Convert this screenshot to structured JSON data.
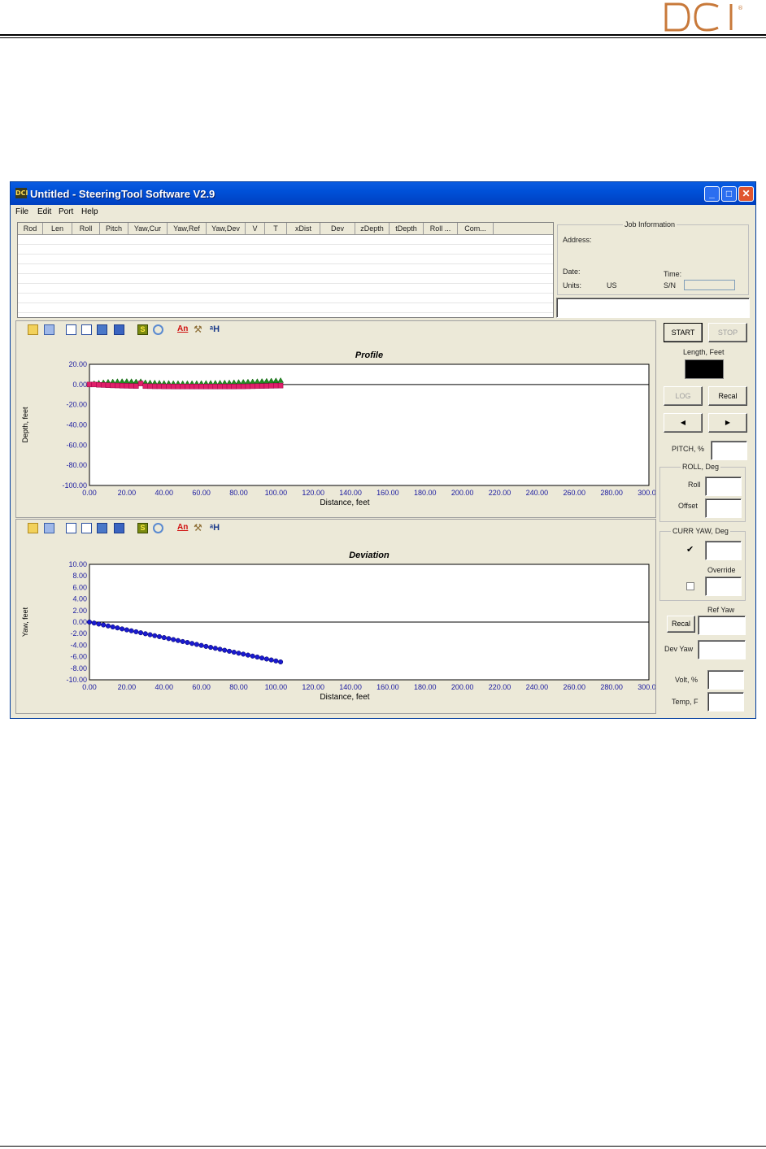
{
  "window": {
    "title": "Untitled - SteeringTool Software V2.9"
  },
  "logo_text": "DCI",
  "menu": [
    "File",
    "Edit",
    "Port",
    "Help"
  ],
  "grid": {
    "columns": [
      "Rod",
      "Len",
      "Roll",
      "Pitch",
      "Yaw,Cur",
      "Yaw,Ref",
      "Yaw,Dev",
      "V",
      "T",
      "xDist",
      "Dev",
      "zDepth",
      "tDepth",
      "Roll ...",
      "Com..."
    ]
  },
  "job": {
    "legend": "Job Information",
    "address_label": "Address:",
    "date_label": "Date:",
    "time_label": "Time:",
    "units_label": "Units:",
    "units_value": "US",
    "sn_label": "S/N"
  },
  "toolbar_icons": [
    "open-icon",
    "copy-icon",
    "page1-icon",
    "page2-icon",
    "list-icon",
    "table-icon",
    "s-icon",
    "zoom-icon",
    "an-icon",
    "tool-icon",
    "key-icon"
  ],
  "controls": {
    "start": "START",
    "stop": "STOP",
    "length_label": "Length, Feet",
    "log": "LOG",
    "recal": "Recal",
    "pitch_label": "PITCH, %",
    "roll_legend": "ROLL, Deg",
    "roll_label": "Roll",
    "offset_label": "Offset",
    "curr_yaw_legend": "CURR YAW, Deg",
    "override_label": "Override",
    "ref_yaw_label": "Ref Yaw",
    "recal2": "Recal",
    "dev_yaw_label": "Dev Yaw",
    "volt_label": "Volt, %",
    "temp_label": "Temp, F",
    "curr_yaw_checked": true,
    "override_checked": false
  },
  "chart_data": [
    {
      "type": "scatter",
      "title": "Profile",
      "xlabel": "Distance, feet",
      "ylabel": "Depth, feet",
      "xlim": [
        0,
        300
      ],
      "ylim": [
        -100,
        20
      ],
      "xticks": [
        "0.00",
        "20.00",
        "40.00",
        "60.00",
        "80.00",
        "100.00",
        "120.00",
        "140.00",
        "160.00",
        "180.00",
        "200.00",
        "220.00",
        "240.00",
        "260.00",
        "280.00",
        "300.00"
      ],
      "yticks": [
        "20.00",
        "0.00",
        "-20.00",
        "-40.00",
        "-60.00",
        "-80.00",
        "-100.00"
      ],
      "series": [
        {
          "color": "#228b22",
          "marker": "triangle",
          "x": [
            0,
            2.5,
            5,
            7.5,
            10,
            12.5,
            15,
            17.5,
            20,
            22.5,
            25,
            27.5,
            30,
            32.5,
            35,
            37.5,
            40,
            42.5,
            45,
            47.5,
            50,
            52.5,
            55,
            57.5,
            60,
            62.5,
            65,
            67.5,
            70,
            72.5,
            75,
            77.5,
            80,
            82.5,
            85,
            87.5,
            90,
            92.5,
            95,
            97.5,
            100,
            102.5
          ],
          "y": [
            0,
            0.5,
            1,
            1.5,
            2,
            2.2,
            2.5,
            2.6,
            2.7,
            2.5,
            2.3,
            2.5,
            1.5,
            1.3,
            1.2,
            1,
            0.8,
            0.8,
            0.6,
            0.6,
            0.5,
            0.5,
            0.6,
            0.6,
            0.7,
            0.8,
            0.9,
            1,
            1.1,
            1.2,
            1.3,
            1.5,
            1.7,
            1.9,
            2.1,
            2.3,
            2.5,
            2.7,
            2.9,
            3.1,
            3.3,
            3.5
          ]
        },
        {
          "color": "#e0206a",
          "marker": "square",
          "x": [
            0,
            2.5,
            5,
            7.5,
            10,
            12.5,
            15,
            17.5,
            20,
            22.5,
            25,
            27.5,
            30,
            32.5,
            35,
            37.5,
            40,
            42.5,
            45,
            47.5,
            50,
            52.5,
            55,
            57.5,
            60,
            62.5,
            65,
            67.5,
            70,
            72.5,
            75,
            77.5,
            80,
            82.5,
            85,
            87.5,
            90,
            92.5,
            95,
            97.5,
            100,
            102.5
          ],
          "y": [
            0,
            0,
            -0.3,
            -0.5,
            -0.7,
            -0.9,
            -1,
            -1.2,
            -1.3,
            -1.4,
            -1.5,
            1,
            -1.6,
            -1.7,
            -1.8,
            -1.8,
            -1.9,
            -1.9,
            -2,
            -2,
            -2,
            -2,
            -2,
            -2,
            -2,
            -2,
            -2,
            -2,
            -2,
            -2,
            -2,
            -2,
            -1.9,
            -1.9,
            -1.8,
            -1.7,
            -1.6,
            -1.5,
            -1.4,
            -1.3,
            -1.2,
            -1.1
          ]
        }
      ]
    },
    {
      "type": "scatter",
      "title": "Deviation",
      "xlabel": "Distance, feet",
      "ylabel": "Yaw, feet",
      "xlim": [
        0,
        300
      ],
      "ylim": [
        -10,
        10
      ],
      "xticks": [
        "0.00",
        "20.00",
        "40.00",
        "60.00",
        "80.00",
        "100.00",
        "120.00",
        "140.00",
        "160.00",
        "180.00",
        "200.00",
        "220.00",
        "240.00",
        "260.00",
        "280.00",
        "300.00"
      ],
      "yticks": [
        "10.00",
        "8.00",
        "6.00",
        "4.00",
        "2.00",
        "0.00",
        "-2.00",
        "-4.00",
        "-6.00",
        "-8.00",
        "-10.00"
      ],
      "series": [
        {
          "color": "#1a1ad0",
          "marker": "circle",
          "x": [
            0,
            2.5,
            5,
            7.5,
            10,
            12.5,
            15,
            17.5,
            20,
            22.5,
            25,
            27.5,
            30,
            32.5,
            35,
            37.5,
            40,
            42.5,
            45,
            47.5,
            50,
            52.5,
            55,
            57.5,
            60,
            62.5,
            65,
            67.5,
            70,
            72.5,
            75,
            77.5,
            80,
            82.5,
            85,
            87.5,
            90,
            92.5,
            95,
            97.5,
            100,
            102.5
          ],
          "y": [
            0,
            -0.17,
            -0.34,
            -0.5,
            -0.67,
            -0.84,
            -1.01,
            -1.18,
            -1.35,
            -1.51,
            -1.68,
            -1.85,
            -2.02,
            -2.19,
            -2.36,
            -2.52,
            -2.69,
            -2.86,
            -3.03,
            -3.2,
            -3.37,
            -3.53,
            -3.7,
            -3.87,
            -4.04,
            -4.21,
            -4.38,
            -4.54,
            -4.71,
            -4.88,
            -5.05,
            -5.22,
            -5.39,
            -5.55,
            -5.72,
            -5.89,
            -6.06,
            -6.23,
            -6.4,
            -6.56,
            -6.73,
            -6.9
          ]
        }
      ]
    }
  ]
}
